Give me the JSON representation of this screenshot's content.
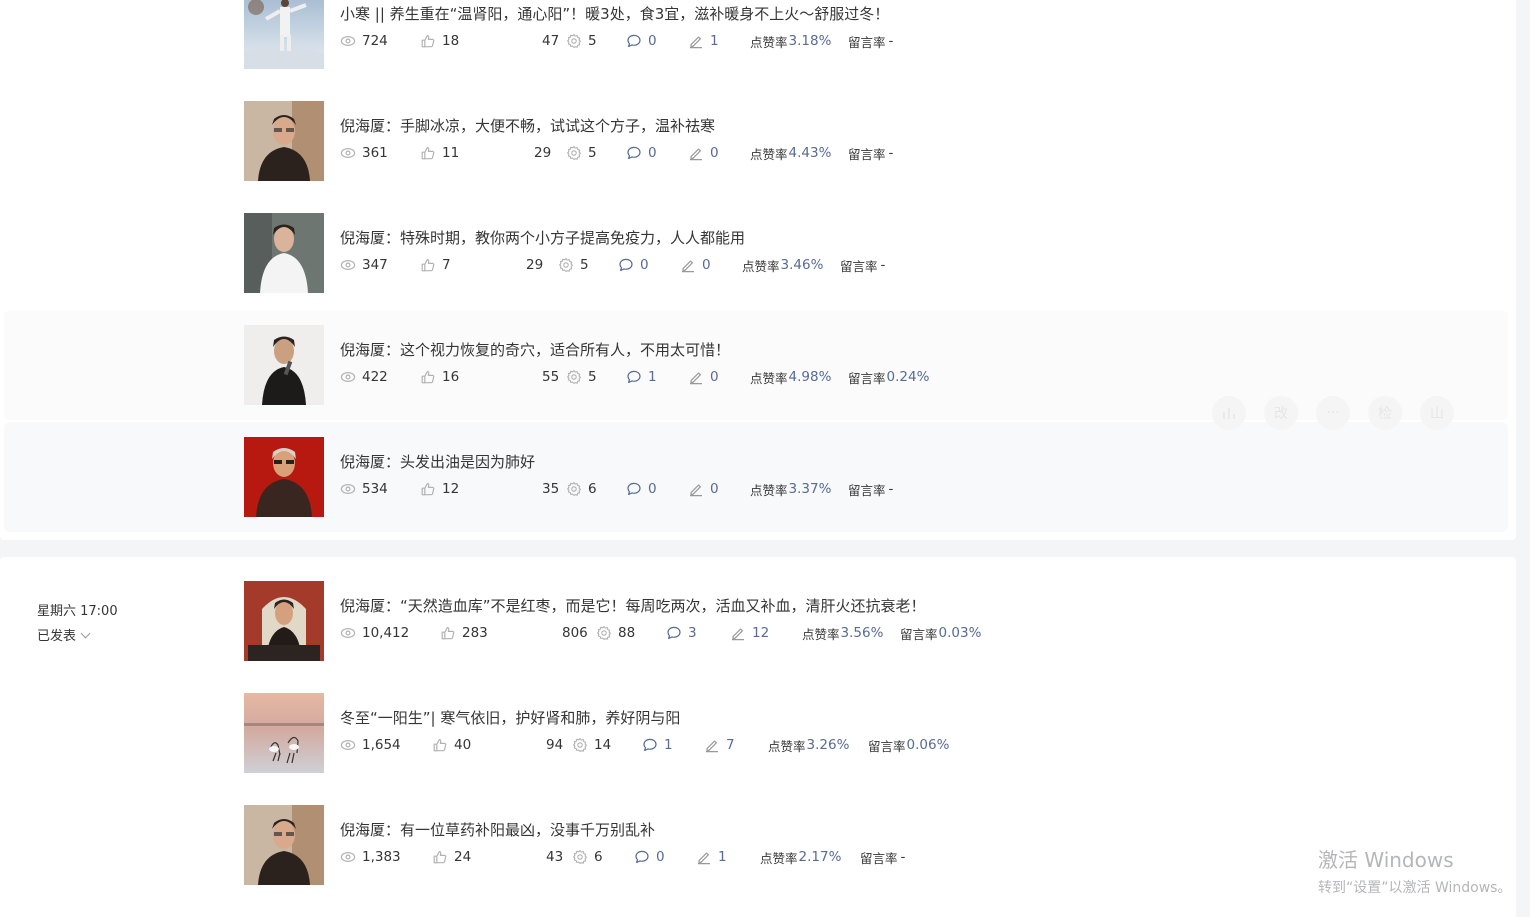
{
  "articles": [
    {
      "title": "小寒 || 养生重在“温肾阳，通心阳”！暖3处，食3宜，滋补暖身不上火～舒服过冬！",
      "reads": "724",
      "likes": "18",
      "shares": "47",
      "wows": "5",
      "comments": "0",
      "edits": "1",
      "like_rate_label": "点赞率",
      "like_rate": "3.18%",
      "comment_rate_label": "留言率",
      "comment_rate": "-",
      "thumb_kind": "snow-taichi"
    },
    {
      "title": "倪海厦：手脚冰凉，大便不畅，试试这个方子，温补祛寒",
      "reads": "361",
      "likes": "11",
      "shares": "29",
      "wows": "5",
      "comments": "0",
      "edits": "0",
      "like_rate_label": "点赞率",
      "like_rate": "4.43%",
      "comment_rate_label": "留言率",
      "comment_rate": "-",
      "thumb_kind": "portrait-light"
    },
    {
      "title": "倪海厦：特殊时期，教你两个小方子提高免疫力，人人都能用",
      "reads": "347",
      "likes": "7",
      "shares": "29",
      "wows": "5",
      "comments": "0",
      "edits": "0",
      "like_rate_label": "点赞率",
      "like_rate": "3.46%",
      "comment_rate_label": "留言率",
      "comment_rate": "-",
      "thumb_kind": "portrait-white-shirt"
    },
    {
      "title": "倪海厦：这个视力恢复的奇穴，适合所有人，不用太可惜！",
      "reads": "422",
      "likes": "16",
      "shares": "55",
      "wows": "5",
      "comments": "1",
      "edits": "0",
      "like_rate_label": "点赞率",
      "like_rate": "4.98%",
      "comment_rate_label": "留言率",
      "comment_rate": "0.24%",
      "thumb_kind": "portrait-mic"
    },
    {
      "title": "倪海厦：头发出油是因为肺好",
      "reads": "534",
      "likes": "12",
      "shares": "35",
      "wows": "6",
      "comments": "0",
      "edits": "0",
      "like_rate_label": "点赞率",
      "like_rate": "3.37%",
      "comment_rate_label": "留言率",
      "comment_rate": "-",
      "thumb_kind": "portrait-red"
    },
    {
      "title": "倪海厦：“天然造血库”不是红枣，而是它！每周吃两次，活血又补血，清肝火还抗衰老！",
      "reads": "10,412",
      "likes": "283",
      "shares": "806",
      "wows": "88",
      "comments": "3",
      "edits": "12",
      "like_rate_label": "点赞率",
      "like_rate": "3.56%",
      "comment_rate_label": "留言率",
      "comment_rate": "0.03%",
      "thumb_kind": "portrait-gate"
    },
    {
      "title": "冬至“一阳生”| 寒气依旧，护好肾和肺，养好阴与阳",
      "reads": "1,654",
      "likes": "40",
      "shares": "94",
      "wows": "14",
      "comments": "1",
      "edits": "7",
      "like_rate_label": "点赞率",
      "like_rate": "3.26%",
      "comment_rate_label": "留言率",
      "comment_rate": "0.06%",
      "thumb_kind": "cranes"
    },
    {
      "title": "倪海厦：有一位草药补阳最凶，没事千万别乱补",
      "reads": "1,383",
      "likes": "24",
      "shares": "43",
      "wows": "6",
      "comments": "0",
      "edits": "1",
      "like_rate_label": "点赞率",
      "like_rate": "2.17%",
      "comment_rate_label": "留言率",
      "comment_rate": "-",
      "thumb_kind": "portrait-light"
    }
  ],
  "group2": {
    "time": "星期六 17:00",
    "status": "已发表"
  },
  "hover_actions": [
    "改",
    "···",
    "检",
    "山"
  ],
  "watermark": {
    "line1": "激活 Windows",
    "line2": "转到“设置”以激活 Windows。"
  },
  "colors": {
    "accent_blue": "#576b95",
    "top_line": "#f0a15b"
  }
}
